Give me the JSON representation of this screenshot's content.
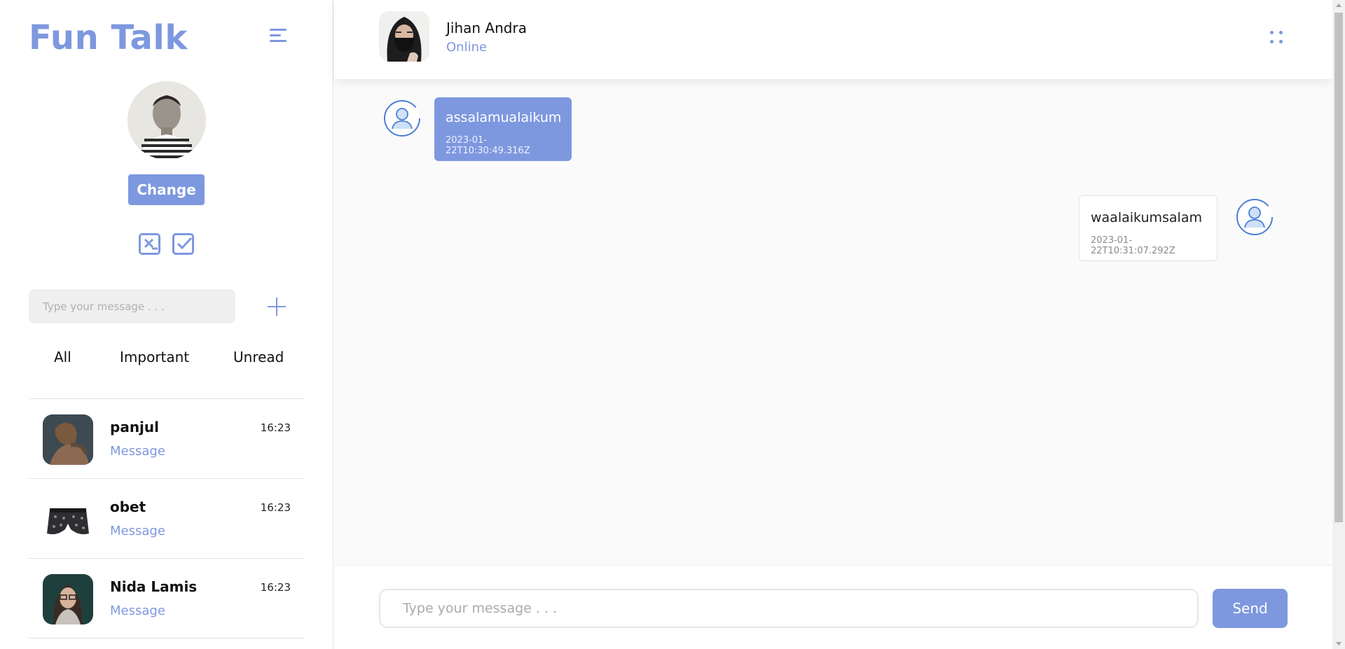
{
  "theme": {
    "accent": "#7e98df",
    "background": "#fafafa"
  },
  "sidebar": {
    "brand": "Fun Talk",
    "menu_icon": "hamburger-menu-icon",
    "profile": {
      "avatar_icon": "user-profile-photo",
      "change_label": "Change"
    },
    "action_icons": [
      "x-square-icon",
      "check-square-icon"
    ],
    "search": {
      "placeholder": "Type your message . . ."
    },
    "add_icon": "plus-icon",
    "filters": [
      "All",
      "Important",
      "Unread"
    ],
    "contacts": [
      {
        "name": "panjul",
        "message": "Message",
        "time": "16:23"
      },
      {
        "name": "obet",
        "message": "Message",
        "time": "16:23"
      },
      {
        "name": "Nida Lamis",
        "message": "Message",
        "time": "16:23"
      }
    ]
  },
  "chat": {
    "header": {
      "name": "Jihan Andra",
      "status": "Online",
      "menu_icon": "dots-grid-icon"
    },
    "messages": [
      {
        "direction": "incoming",
        "text": "assalamualaikum",
        "time": "2023-01-22T10:30:49.316Z"
      },
      {
        "direction": "outgoing",
        "text": "waalaikumsalam",
        "time": "2023-01-22T10:31:07.292Z"
      }
    ],
    "composer": {
      "placeholder": "Type your message . . .",
      "send_label": "Send"
    }
  }
}
